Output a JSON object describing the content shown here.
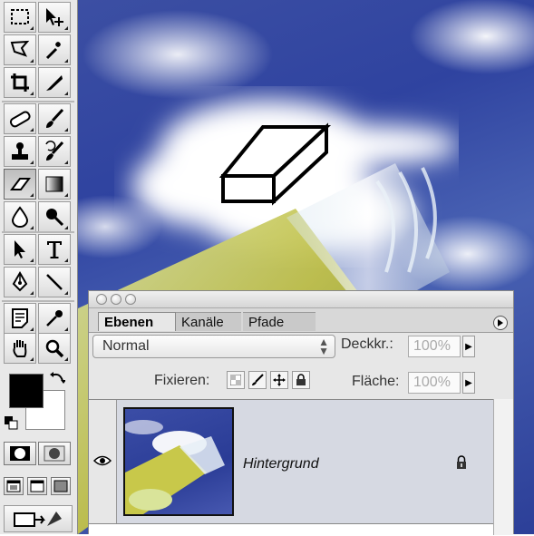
{
  "toolbox": {
    "tools": [
      {
        "name": "marquee-tool",
        "icon": "rect-marquee-icon"
      },
      {
        "name": "move-tool",
        "icon": "move-icon"
      },
      {
        "name": "lasso-tool",
        "icon": "lasso-icon"
      },
      {
        "name": "magic-wand-tool",
        "icon": "magic-wand-icon"
      },
      {
        "name": "crop-tool",
        "icon": "crop-icon"
      },
      {
        "name": "slice-tool",
        "icon": "slice-knife-icon"
      },
      {
        "name": "healing-brush-tool",
        "icon": "bandage-icon"
      },
      {
        "name": "brush-tool",
        "icon": "brush-icon"
      },
      {
        "name": "clone-stamp-tool",
        "icon": "stamp-icon"
      },
      {
        "name": "history-brush-tool",
        "icon": "history-brush-icon"
      },
      {
        "name": "eraser-tool",
        "icon": "eraser-icon",
        "active": true
      },
      {
        "name": "gradient-tool",
        "icon": "gradient-icon"
      },
      {
        "name": "blur-tool",
        "icon": "drop-icon"
      },
      {
        "name": "dodge-tool",
        "icon": "dodge-icon"
      },
      {
        "name": "path-selection-tool",
        "icon": "arrow-icon"
      },
      {
        "name": "type-tool",
        "icon": "type-icon"
      },
      {
        "name": "pen-tool",
        "icon": "pen-icon"
      },
      {
        "name": "line-tool",
        "icon": "line-icon"
      },
      {
        "name": "notes-tool",
        "icon": "note-icon"
      },
      {
        "name": "eyedropper-tool",
        "icon": "eyedropper-icon"
      },
      {
        "name": "hand-tool",
        "icon": "hand-icon"
      },
      {
        "name": "zoom-tool",
        "icon": "magnifier-icon"
      }
    ],
    "foreground_color": "#000000",
    "background_color": "#ffffff"
  },
  "layers_panel": {
    "tabs": [
      {
        "label": "Ebenen",
        "active": true
      },
      {
        "label": "Kanäle",
        "active": false
      },
      {
        "label": "Pfade",
        "active": false
      }
    ],
    "blend_mode": "Normal",
    "opacity_label": "Deckkr.:",
    "opacity_value": "100%",
    "lock_label": "Fixieren:",
    "fill_label": "Fläche:",
    "fill_value": "100%",
    "layer": {
      "name": "Hintergrund",
      "visible": true,
      "locked": true
    }
  }
}
